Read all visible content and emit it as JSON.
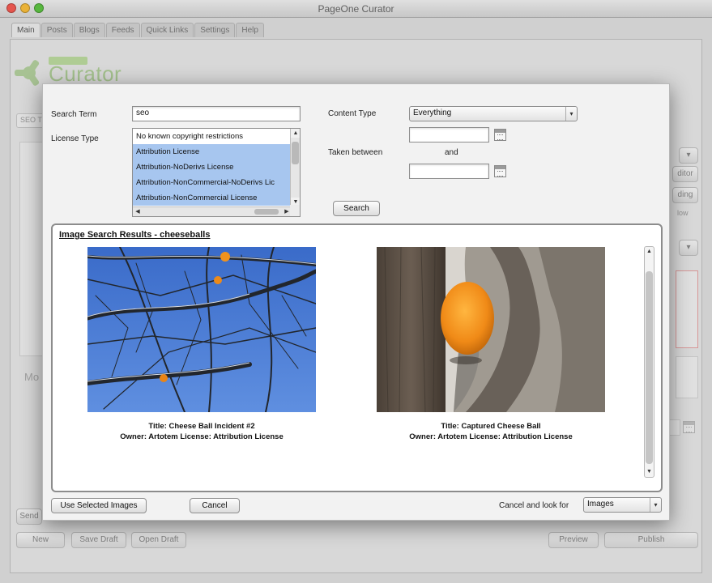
{
  "window": {
    "title": "PageOne Curator"
  },
  "tabs": [
    "Main",
    "Posts",
    "Blogs",
    "Feeds",
    "Quick Links",
    "Settings",
    "Help"
  ],
  "logo": {
    "text": "Curator"
  },
  "background": {
    "seo_label": "SEO T",
    "more_label": "Mo",
    "buttons": {
      "new": "New",
      "save_draft": "Save Draft",
      "open_draft": "Open Draft",
      "preview": "Preview",
      "publish": "Publish",
      "send": "Send"
    },
    "side_buttons": {
      "editor": "ditor",
      "loading": "ding",
      "flow": "low"
    }
  },
  "dialog": {
    "search_term_label": "Search Term",
    "search_term_value": "seo",
    "license_type_label": "License Type",
    "license_options": [
      {
        "label": "No known copyright restrictions",
        "selected": false
      },
      {
        "label": "Attribution License",
        "selected": true
      },
      {
        "label": "Attribution-NoDerivs License",
        "selected": true
      },
      {
        "label": "Attribution-NonCommercial-NoDerivs Lic",
        "selected": true
      },
      {
        "label": "Attribution-NonCommercial License",
        "selected": true
      }
    ],
    "content_type_label": "Content Type",
    "content_type_value": "Everything",
    "taken_between_label": "Taken between",
    "and_label": "and",
    "date_from": "",
    "date_to": "",
    "search_button": "Search",
    "results_title": "Image Search Results - cheeseballs",
    "results": [
      {
        "title_line": "Title: Cheese Ball Incident #2",
        "owner_line": "Owner: Artotem License: Attribution License",
        "scene": "tree-branches-with-orange-balls"
      },
      {
        "title_line": "Title: Captured Cheese Ball",
        "owner_line": "Owner: Artotem License: Attribution License",
        "scene": "cheese-ball-in-tree-hollow"
      }
    ],
    "use_selected_button": "Use Selected Images",
    "cancel_button": "Cancel",
    "cancel_look_label": "Cancel and look for",
    "look_for_value": "Images"
  },
  "colors": {
    "selection": "#a7c6ef",
    "sky": "#3d6ecd",
    "cheese": "#f0921e"
  }
}
